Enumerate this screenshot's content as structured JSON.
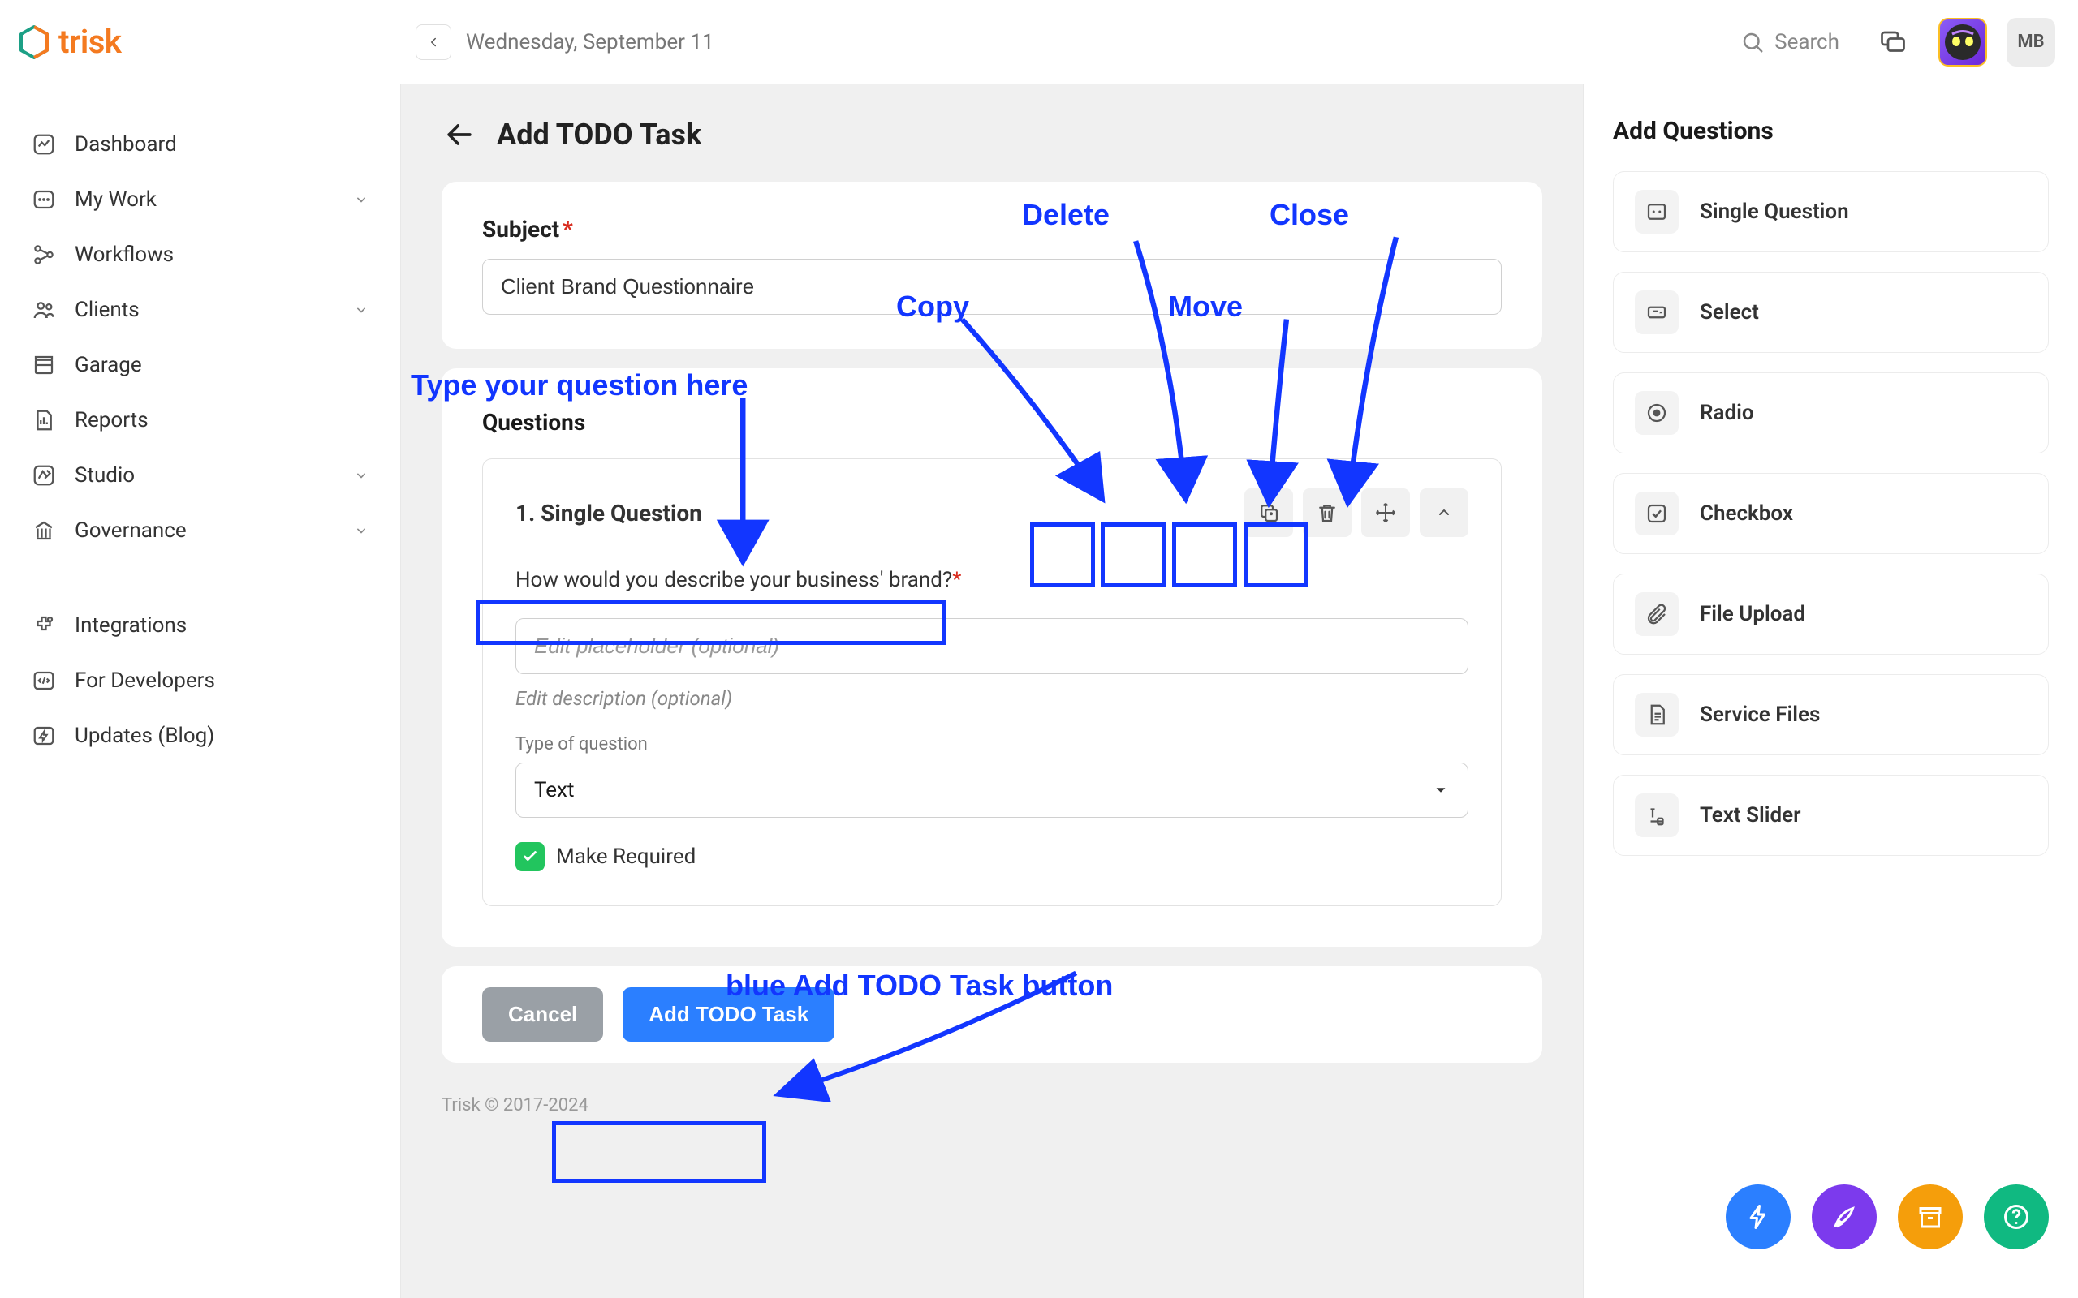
{
  "topbar": {
    "date": "Wednesday, September 11",
    "search_placeholder": "Search",
    "user_initials": "MB"
  },
  "sidebar": {
    "items": [
      {
        "label": "Dashboard",
        "expandable": false
      },
      {
        "label": "My Work",
        "expandable": true
      },
      {
        "label": "Workflows",
        "expandable": false
      },
      {
        "label": "Clients",
        "expandable": true
      },
      {
        "label": "Garage",
        "expandable": false
      },
      {
        "label": "Reports",
        "expandable": false
      },
      {
        "label": "Studio",
        "expandable": true
      },
      {
        "label": "Governance",
        "expandable": true
      }
    ],
    "secondary": [
      {
        "label": "Integrations"
      },
      {
        "label": "For Developers"
      },
      {
        "label": "Updates (Blog)"
      }
    ]
  },
  "page": {
    "title": "Add TODO Task",
    "subject_label": "Subject",
    "subject_value": "Client Brand Questionnaire",
    "questions_heading": "Questions",
    "question": {
      "index": "1.",
      "type_label": "Single Question",
      "text": "How would you describe your business' brand?",
      "placeholder_input": "Edit placeholder (optional)",
      "description_hint": "Edit description (optional)",
      "type_of_question_label": "Type of question",
      "type_of_question_value": "Text",
      "make_required_label": "Make Required",
      "make_required_checked": true
    },
    "footer": {
      "cancel": "Cancel",
      "submit": "Add TODO Task"
    },
    "copyright": "Trisk © 2017-2024"
  },
  "rightpanel": {
    "title": "Add Questions",
    "items": [
      "Single Question",
      "Select",
      "Radio",
      "Checkbox",
      "File Upload",
      "Service Files",
      "Text Slider"
    ]
  },
  "annotations": {
    "copy": "Copy",
    "delete": "Delete",
    "close": "Close",
    "move": "Move",
    "type_here": "Type your question here",
    "add_button": "blue Add TODO Task button"
  }
}
